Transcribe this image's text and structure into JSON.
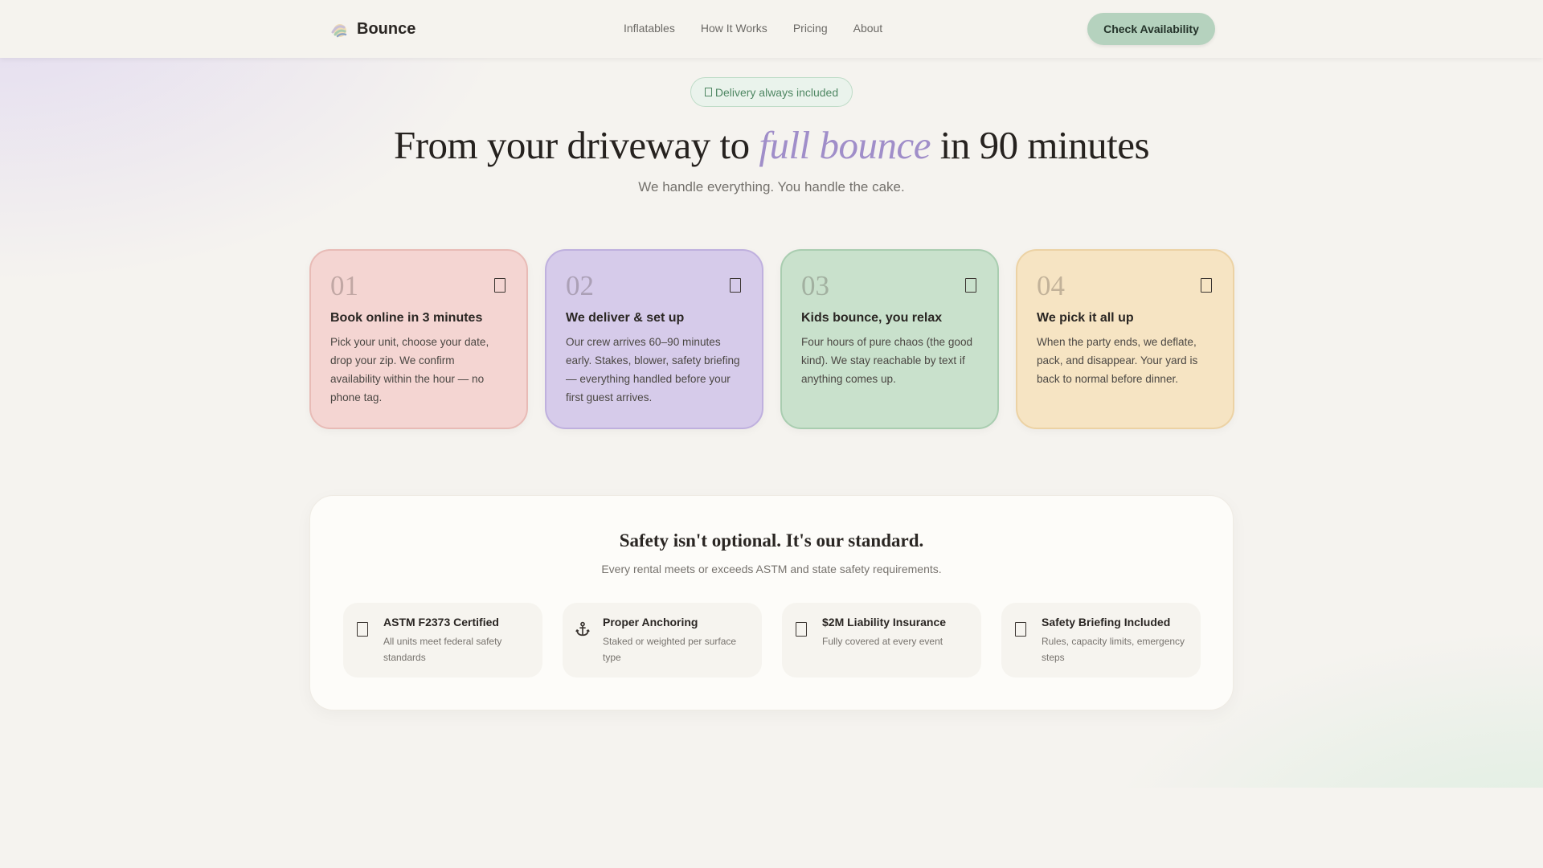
{
  "nav": {
    "brand": "Bounce",
    "links": [
      "Inflatables",
      "How It Works",
      "Pricing",
      "About"
    ],
    "cta": "Check Availability"
  },
  "hero": {
    "badge": "Delivery always included",
    "title_before": "From your driveway to ",
    "title_highlight": "full bounce",
    "title_after": " in 90 minutes",
    "subtitle": "We handle everything. You handle the cake."
  },
  "steps": [
    {
      "num": "01",
      "title": "Book online in 3 minutes",
      "desc": "Pick your unit, choose your date, drop your zip. We confirm availability within the hour — no phone tag."
    },
    {
      "num": "02",
      "title": "We deliver & set up",
      "desc": "Our crew arrives 60–90 minutes early. Stakes, blower, safety briefing — everything handled before your first guest arrives."
    },
    {
      "num": "03",
      "title": "Kids bounce, you relax",
      "desc": "Four hours of pure chaos (the good kind). We stay reachable by text if anything comes up."
    },
    {
      "num": "04",
      "title": "We pick it all up",
      "desc": "When the party ends, we deflate, pack, and disappear. Your yard is back to normal before dinner."
    }
  ],
  "safety": {
    "title": "Safety isn't optional. It's our standard.",
    "subtitle": "Every rental meets or exceeds ASTM and state safety requirements.",
    "features": [
      {
        "title": "ASTM F2373 Certified",
        "desc": "All units meet federal safety standards",
        "icon": "certificate-icon"
      },
      {
        "title": "Proper Anchoring",
        "desc": "Staked or weighted per surface type",
        "icon": "anchor-icon"
      },
      {
        "title": "$2M Liability Insurance",
        "desc": "Fully covered at every event",
        "icon": "shield-icon"
      },
      {
        "title": "Safety Briefing Included",
        "desc": "Rules, capacity limits, emergency steps",
        "icon": "clipboard-icon"
      }
    ]
  },
  "colors": {
    "accent": "#a08ec9",
    "cta": "#b5d2be",
    "step_1": "#f4d5d2",
    "step_2": "#d6cbea",
    "step_3": "#c9e1cc",
    "step_4": "#f6e4c3"
  }
}
